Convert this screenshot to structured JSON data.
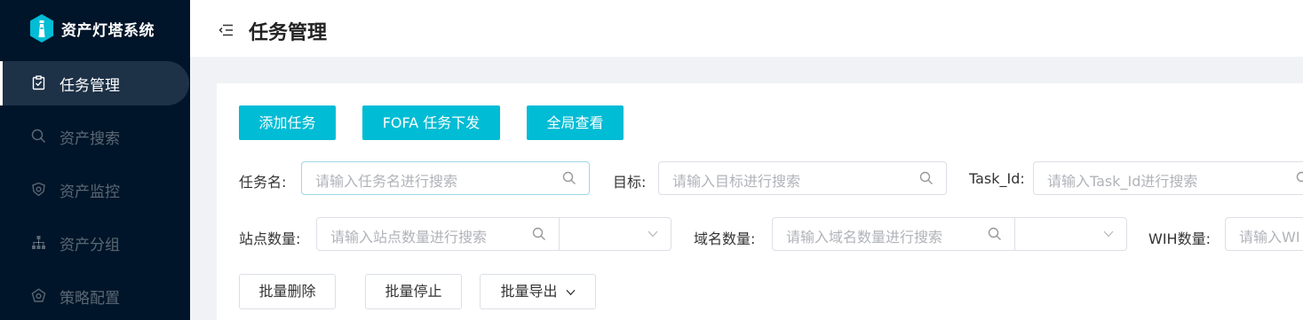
{
  "app": {
    "name": "资产灯塔系统"
  },
  "sidebar": {
    "items": [
      {
        "label": "任务管理",
        "icon": "clipboard-icon",
        "active": true
      },
      {
        "label": "资产搜索",
        "icon": "search-icon",
        "active": false
      },
      {
        "label": "资产监控",
        "icon": "shield-icon",
        "active": false
      },
      {
        "label": "资产分组",
        "icon": "sitemap-icon",
        "active": false
      },
      {
        "label": "策略配置",
        "icon": "settings-icon",
        "active": false
      }
    ]
  },
  "header": {
    "title": "任务管理",
    "menu_icon": "menu-fold-icon"
  },
  "toolbar": {
    "add_task": "添加任务",
    "fofa_task": "FOFA 任务下发",
    "global_view": "全局查看"
  },
  "filters": {
    "task_name": {
      "label": "任务名:",
      "placeholder": "请输入任务名进行搜索"
    },
    "target": {
      "label": "目标:",
      "placeholder": "请输入目标进行搜索"
    },
    "task_id": {
      "label": "Task_Id:",
      "placeholder": "请输入Task_Id进行搜索"
    },
    "site_count": {
      "label": "站点数量:",
      "placeholder": "请输入站点数量进行搜索"
    },
    "domain_count": {
      "label": "域名数量:",
      "placeholder": "请输入域名数量进行搜索"
    },
    "wih_count": {
      "label": "WIH数量:",
      "placeholder": "请输入WI"
    }
  },
  "bulk": {
    "delete": "批量删除",
    "stop": "批量停止",
    "export": "批量导出"
  },
  "colors": {
    "primary": "#00bcd4",
    "sidebar_bg": "#001529",
    "active_bg": "#1d3147"
  }
}
